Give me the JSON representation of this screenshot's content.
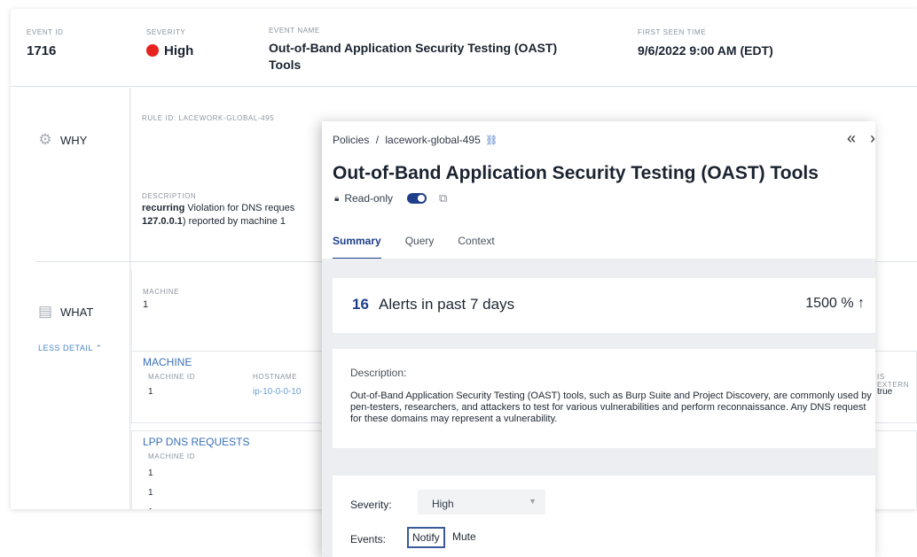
{
  "header": {
    "event_id_label": "EVENT ID",
    "event_id": "1716",
    "severity_label": "SEVERITY",
    "severity": "High",
    "event_name_label": "EVENT NAME",
    "event_name_line1": "Out-of-Band Application Security Testing (OAST)",
    "event_name_line2": "Tools",
    "first_seen_label": "FIRST SEEN TIME",
    "first_seen": "9/6/2022 9:00 AM (EDT)"
  },
  "nav": {
    "why_label": "WHY",
    "what_label": "WHAT",
    "less_detail": "LESS DETAIL"
  },
  "why": {
    "rule_id": "RULE ID: LACEWORK-GLOBAL-495",
    "description_label": "DESCRIPTION",
    "desc_bold": "recurring",
    "desc_rest": " Violation for DNS reques",
    "desc_line2_bold": "127.0.0.1",
    "desc_line2_rest": ") reported by machine 1"
  },
  "what": {
    "machine_label": "MACHINE",
    "machine_value": "1",
    "machine_head": "MACHINE",
    "machine_id_col": "MACHINE ID",
    "hostname_col": "HOSTNAME",
    "machine_id_val": "1",
    "hostname_val": "ip-10-0-0-10",
    "is_external_col": "IS EXTERN",
    "is_external_val": "true",
    "lpp_head": "LPP DNS REQUESTS",
    "lpp_machine_id_col": "MACHINE ID",
    "lpp_rows": [
      "1",
      "1",
      "1"
    ]
  },
  "drawer": {
    "crumb_root": "Policies",
    "crumb_sep": "/",
    "crumb_leaf": "lacework-global-495",
    "title": "Out-of-Band Application Security Testing (OAST) Tools",
    "readonly": "Read-only",
    "tabs": [
      "Summary",
      "Query",
      "Context"
    ],
    "alerts_count": "16",
    "alerts_text": "Alerts in past 7 days",
    "alerts_pct": "1500 %",
    "description_label": "Description:",
    "description": "Out-of-Band Application Security Testing (OAST) tools, such as Burp Suite and Project Discovery, are commonly used by pen-testers, researchers, and attackers to test for various vulnerabilities and perform reconnaissance. Any DNS request for these domains may represent a vulnerability.",
    "severity_label": "Severity:",
    "severity_value": "High",
    "events_label": "Events:",
    "notify": "Notify",
    "mute": "Mute"
  },
  "colors": {
    "severity_high": "#e8231f",
    "accent": "#1f3f8a",
    "link": "#3a70b9"
  }
}
